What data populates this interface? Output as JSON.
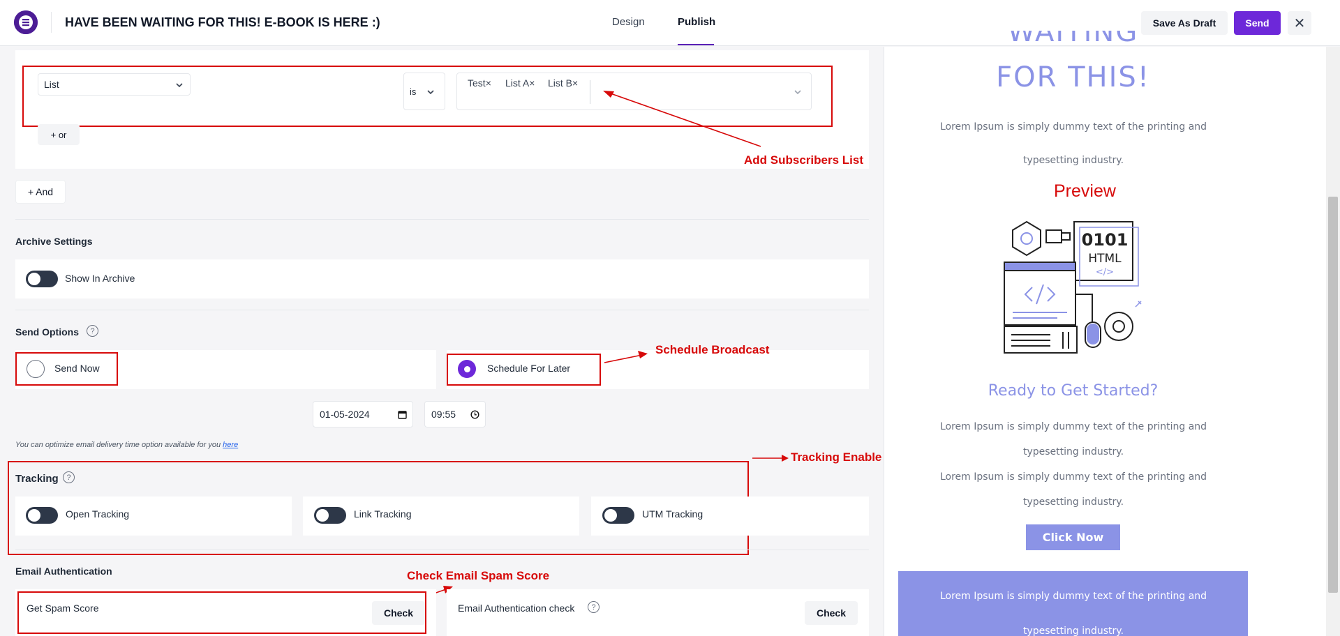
{
  "header": {
    "title": "HAVE BEEN WAITING FOR THIS! E-BOOK IS HERE :)",
    "tabs": [
      "Design",
      "Publish"
    ],
    "active_tab": "Publish",
    "save_draft": "Save As Draft",
    "send": "Send",
    "close": "✕"
  },
  "filter": {
    "field": "List",
    "operator": "is",
    "chips": [
      "Test",
      "List A",
      "List B"
    ],
    "chip_remove": "×",
    "or_button": "+ or",
    "and_button": "+ And"
  },
  "archive": {
    "heading": "Archive Settings",
    "show_in_archive": "Show In Archive"
  },
  "send_options": {
    "heading": "Send Options",
    "help": "?",
    "send_now": "Send Now",
    "schedule_later": "Schedule For Later",
    "selected": "Schedule For Later",
    "date": "01-05-2024",
    "time": "09:55",
    "note": "You can optimize email delivery time option available for you",
    "note_link": "here"
  },
  "tracking": {
    "heading": "Tracking",
    "help": "?",
    "items": [
      "Open Tracking",
      "Link Tracking",
      "UTM Tracking"
    ]
  },
  "auth": {
    "heading": "Email Authentication",
    "spam_label": "Get Spam Score",
    "spam_button": "Check",
    "auth_label": "Email Authentication check",
    "help": "?",
    "auth_button": "Check"
  },
  "annotations": {
    "subscribers": "Add Subscribers List",
    "schedule": "Schedule Broadcast",
    "tracking": "Tracking Enable",
    "spam": "Check Email Spam Score",
    "preview": "Preview"
  },
  "preview": {
    "heading_line1": "WAITING",
    "heading_line2": "FOR THIS!",
    "lorem1": "Lorem Ipsum is simply dummy text of the printing and typesetting industry.",
    "image_text_1": "0101",
    "image_text_2": "HTML",
    "image_text_3": "</>",
    "ready": "Ready to Get Started?",
    "lorem2": "Lorem Ipsum is simply dummy text of the printing and typesetting industry.",
    "lorem3": "Lorem Ipsum is simply dummy text of the printing and typesetting industry.",
    "cta": "Click Now",
    "footer_lorem": "Lorem Ipsum is simply dummy text of the printing and typesetting industry."
  },
  "colors": {
    "accent": "#6d28d9",
    "annotation": "#d70a0a",
    "preview_accent": "#8b93e6"
  }
}
